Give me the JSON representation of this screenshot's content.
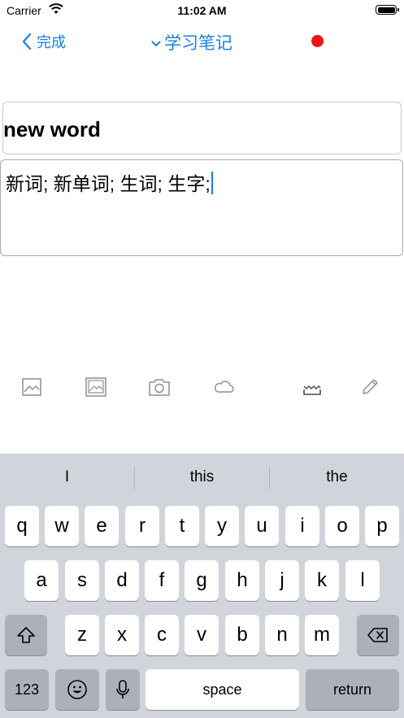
{
  "status_bar": {
    "carrier": "Carrier",
    "time": "11:02 AM"
  },
  "nav": {
    "back_label": "完成",
    "title": "学习笔记",
    "record_color": "#ee1515"
  },
  "note": {
    "title_value": "new word",
    "body_value": "新词; 新单词; 生词; 生字;"
  },
  "toolbar": {
    "items": [
      "image-icon",
      "gallery-icon",
      "camera-icon",
      "cloud-icon",
      "scan-icon",
      "pencil-icon"
    ]
  },
  "keyboard": {
    "suggestions": [
      "I",
      "this",
      "the"
    ],
    "row1": [
      "q",
      "w",
      "e",
      "r",
      "t",
      "y",
      "u",
      "i",
      "o",
      "p"
    ],
    "row2": [
      "a",
      "s",
      "d",
      "f",
      "g",
      "h",
      "j",
      "k",
      "l"
    ],
    "row3": [
      "z",
      "x",
      "c",
      "v",
      "b",
      "n",
      "m"
    ],
    "numbers_label": "123",
    "space_label": "space",
    "return_label": "return"
  },
  "colors": {
    "accent": "#1a7fe3",
    "keyboard_bg": "#d1d4da",
    "key_dark": "#abb0ba"
  }
}
